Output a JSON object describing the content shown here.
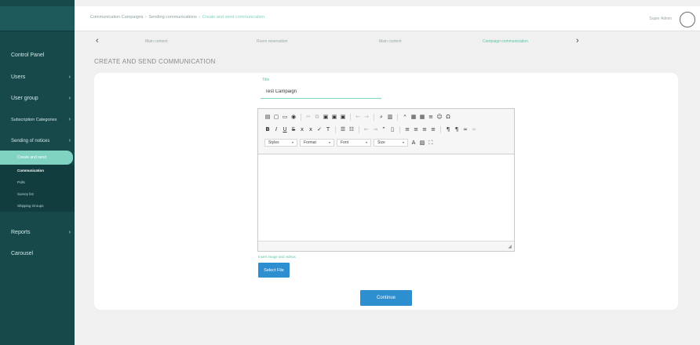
{
  "topbar": {
    "breadcrumb": [
      "Communication Campaigns",
      "Sending communications",
      "Create and send communication"
    ],
    "user_name": "Super Admin"
  },
  "sidebar": {
    "items": [
      {
        "label": "Control Panel",
        "chevron": false
      },
      {
        "label": "Users",
        "chevron": true
      },
      {
        "label": "User group",
        "chevron": true
      },
      {
        "label": "Subscription Categories",
        "chevron": true
      },
      {
        "label": "Sending of notices",
        "chevron": true
      },
      {
        "label": "Reports",
        "chevron": true
      },
      {
        "label": "Carousel",
        "chevron": false
      }
    ],
    "active_item": "Create and send",
    "sub_items": [
      "Communication",
      "Polls",
      "Survey list",
      "Shipping Groups"
    ]
  },
  "steps": {
    "prev_arrow": "‹",
    "next_arrow": "›",
    "items": [
      "Main content",
      "Room reservation",
      "Main content",
      "Campaign communication"
    ],
    "active_index": 3
  },
  "page_title": "CREATE AND SEND COMMUNICATION",
  "form": {
    "title_label": "Title",
    "title_value": "Test Campaign",
    "editor": {
      "styles_label": "Styles",
      "format_label": "Format",
      "font_label": "Font",
      "size_label": "Size"
    },
    "insert_label": "Insert image and videos",
    "select_file_label": "Select File",
    "continue_label": "Continue"
  },
  "colors": {
    "sidebar_bg": "#17484a",
    "accent": "#7fd3c0",
    "button_blue": "#2d8fcf"
  }
}
